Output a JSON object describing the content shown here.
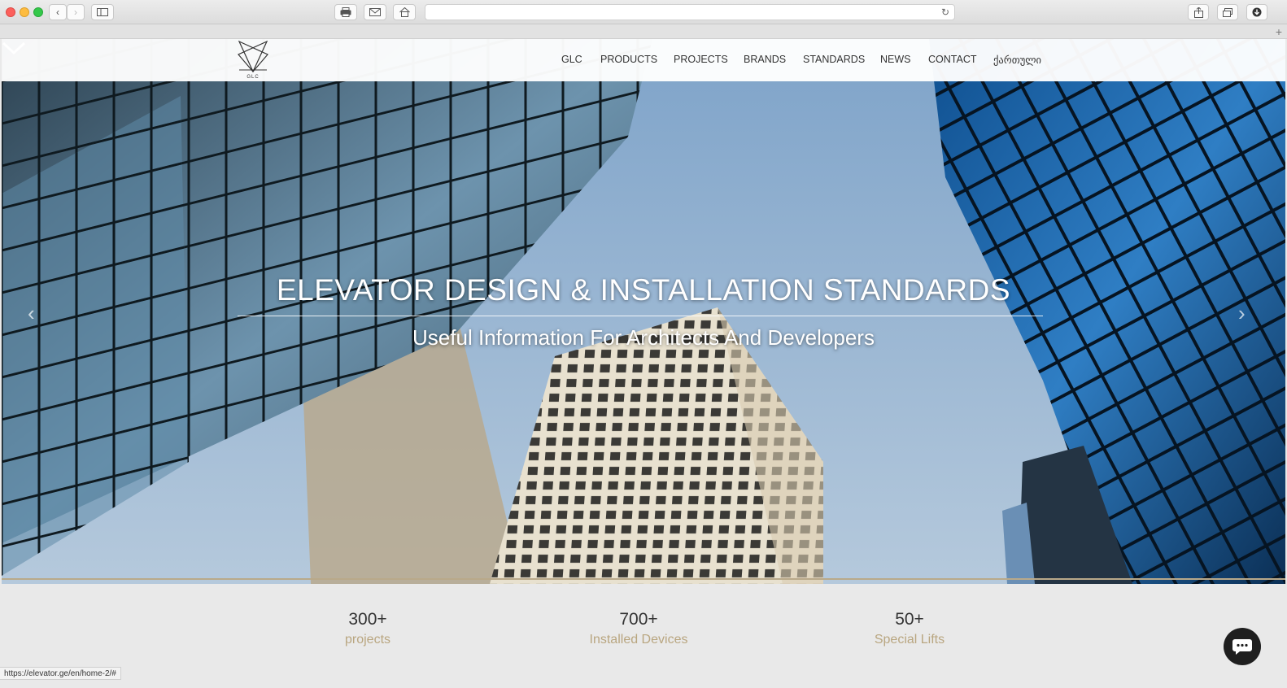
{
  "browser": {
    "url": "",
    "status_url": "https://elevator.ge/en/home-2/#"
  },
  "logo": {
    "text": "GLC"
  },
  "nav": {
    "items": [
      {
        "label": "GLC"
      },
      {
        "label": "PRODUCTS"
      },
      {
        "label": "PROJECTS"
      },
      {
        "label": "BRANDS"
      },
      {
        "label": "STANDARDS"
      },
      {
        "label": "NEWS"
      },
      {
        "label": "CONTACT"
      },
      {
        "label": "ქართული"
      }
    ]
  },
  "hero": {
    "title": "ELEVATOR DESIGN & INSTALLATION STANDARDS",
    "subtitle": "Useful Information For Architects And Developers"
  },
  "stats": [
    {
      "value": "300+",
      "label": "projects"
    },
    {
      "value": "700+",
      "label": "Installed Devices"
    },
    {
      "value": "50+",
      "label": "Special Lifts"
    }
  ],
  "colors": {
    "accent": "#b9a680",
    "nav_text": "#333333"
  }
}
